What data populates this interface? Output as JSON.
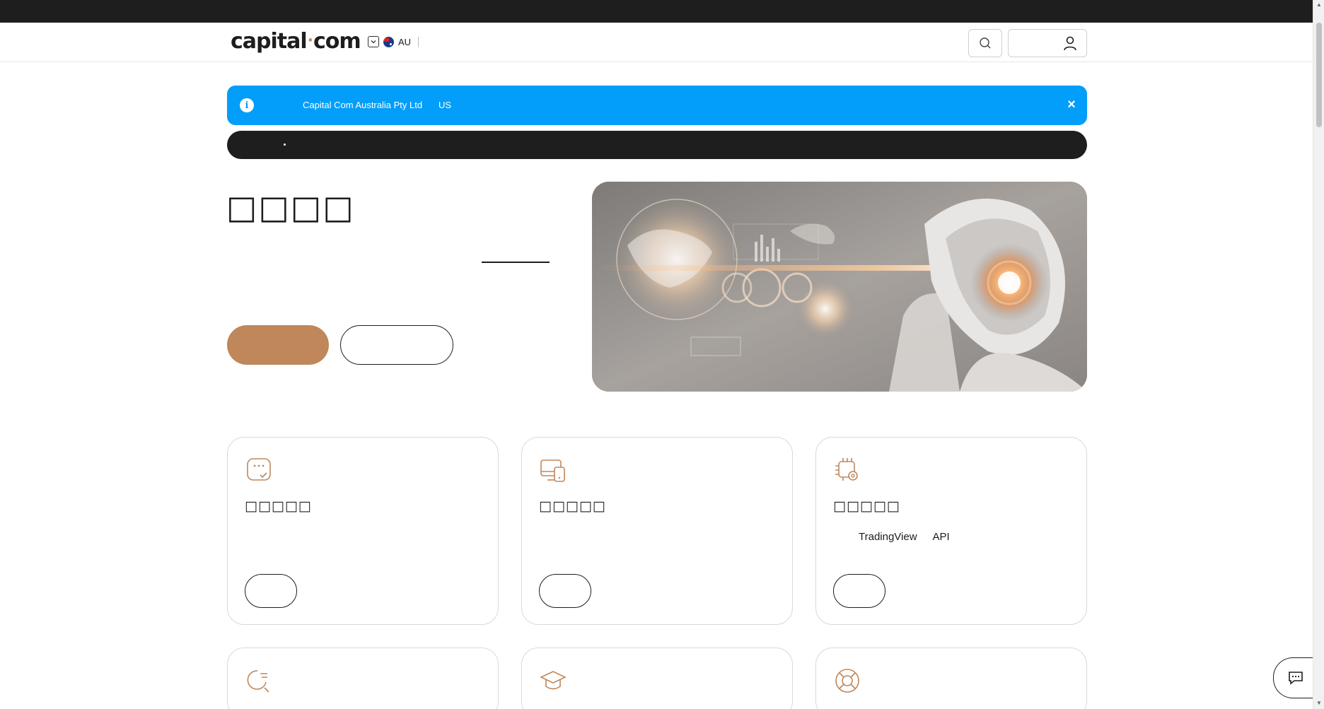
{
  "header": {
    "logo_word_left": "capital",
    "logo_dot": "·",
    "logo_word_right": "com",
    "region_code": "AU"
  },
  "notice": {
    "entity": "Capital Com Australia Pty Ltd",
    "country": "US",
    "close_symbol": "×",
    "info_symbol": "i"
  },
  "hero": {
    "title": "□□□□"
  },
  "cards": [
    {
      "title": "□□□□□",
      "icon": "chat-check-icon"
    },
    {
      "title": "□□□□□",
      "icon": "devices-icon"
    },
    {
      "title": "□□□□□",
      "icon": "chip-gear-icon",
      "desc_a": "TradingView",
      "desc_b": "API"
    },
    {
      "icon": "search-chart-icon"
    },
    {
      "icon": "graduation-cap-icon"
    },
    {
      "icon": "lifebuoy-icon"
    }
  ],
  "colors": {
    "accent": "#c0875a",
    "notice_blue": "#039ef9",
    "dark": "#1e1e1e"
  }
}
